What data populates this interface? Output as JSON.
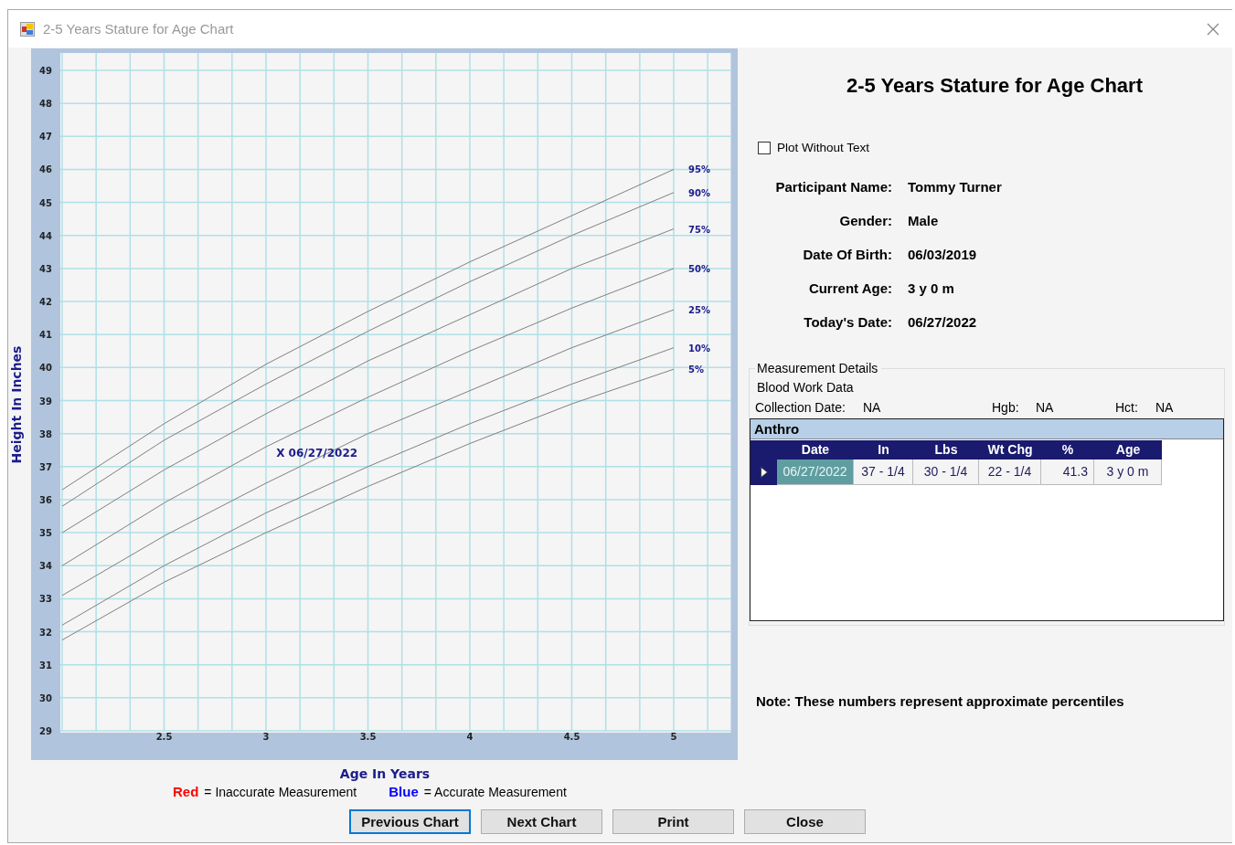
{
  "window": {
    "title": "2-5 Years Stature for Age Chart"
  },
  "chart": {
    "chart_data": {
      "type": "line",
      "xlabel": "Age In Years",
      "ylabel": "Height In Inches",
      "x": [
        2,
        2.5,
        3,
        3.5,
        4,
        4.5,
        5
      ],
      "xlim": [
        2,
        5.28
      ],
      "ylim": [
        29,
        49
      ],
      "xticks": [
        2.5,
        3,
        3.5,
        4,
        4.5,
        5
      ],
      "yticks": [
        29,
        30,
        31,
        32,
        33,
        34,
        35,
        36,
        37,
        38,
        39,
        40,
        41,
        42,
        43,
        44,
        45,
        46,
        47,
        48,
        49
      ],
      "grid": true,
      "series": [
        {
          "name": "95%",
          "color": "#808080",
          "values": [
            36.3,
            38.3,
            40.1,
            41.7,
            43.2,
            44.6,
            46.0
          ]
        },
        {
          "name": "90%",
          "color": "#808080",
          "values": [
            35.8,
            37.8,
            39.5,
            41.1,
            42.6,
            44.0,
            45.3
          ]
        },
        {
          "name": "75%",
          "color": "#808080",
          "values": [
            35.0,
            36.9,
            38.6,
            40.2,
            41.6,
            43.0,
            44.2
          ]
        },
        {
          "name": "50%",
          "color": "#808080",
          "values": [
            34.0,
            35.9,
            37.6,
            39.1,
            40.5,
            41.8,
            43.0
          ]
        },
        {
          "name": "25%",
          "color": "#808080",
          "values": [
            33.1,
            34.9,
            36.5,
            38.0,
            39.3,
            40.6,
            41.75
          ]
        },
        {
          "name": "10%",
          "color": "#808080",
          "values": [
            32.2,
            34.0,
            35.6,
            37.0,
            38.3,
            39.5,
            40.6
          ]
        },
        {
          "name": "5%",
          "color": "#808080",
          "values": [
            31.75,
            33.5,
            35.0,
            36.4,
            37.7,
            38.9,
            39.95
          ]
        }
      ],
      "annotations": [
        "X 06/27/2022"
      ]
    }
  },
  "panel": {
    "title": "2-5 Years Stature for Age Chart",
    "plot_without_text": {
      "label": "Plot Without Text",
      "checked": false
    },
    "fields": [
      {
        "label": "Participant Name:",
        "value": "Tommy Turner"
      },
      {
        "label": "Gender:",
        "value": "Male"
      },
      {
        "label": "Date Of Birth:",
        "value": "06/03/2019"
      },
      {
        "label": "Current Age:",
        "value": "3 y 0 m"
      },
      {
        "label": "Today's Date:",
        "value": "06/27/2022"
      }
    ],
    "measurement_details": {
      "title": "Measurement Details",
      "subtitle": "Blood Work Data",
      "blood": [
        {
          "label": "Collection Date:",
          "value": "NA"
        },
        {
          "label": "Hgb:",
          "value": "NA"
        },
        {
          "label": "Hct:",
          "value": "NA"
        }
      ],
      "anthro": {
        "title": "Anthro",
        "columns": [
          "Date",
          "In",
          "Lbs",
          "Wt Chg",
          "%",
          "Age"
        ],
        "rows": [
          {
            "selected": true,
            "cells": [
              "06/27/2022",
              "37 - 1/4",
              "30 - 1/4",
              "22 - 1/4",
              "41.3",
              "3 y 0 m"
            ]
          }
        ]
      }
    },
    "note": "Note: These numbers represent approximate percentiles"
  },
  "legend": [
    {
      "key": "Red",
      "color": "#ff0000",
      "text": "= Inaccurate Measurement"
    },
    {
      "key": "Blue",
      "color": "#0000ff",
      "text": "= Accurate Measurement"
    }
  ],
  "buttons": [
    {
      "label": "Previous Chart",
      "focused": true
    },
    {
      "label": "Next Chart",
      "focused": false
    },
    {
      "label": "Print",
      "focused": false
    },
    {
      "label": "Close",
      "focused": false
    }
  ]
}
